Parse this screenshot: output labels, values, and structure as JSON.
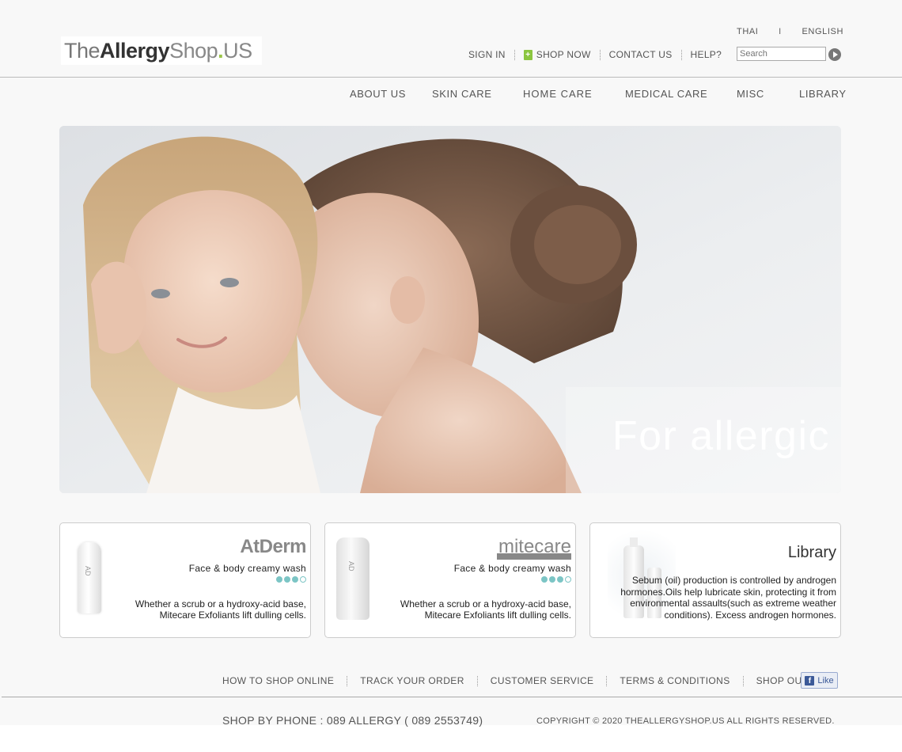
{
  "header": {
    "logo": {
      "part1": "The",
      "part2": "Allergy",
      "part3": "Shop",
      "dot": ".",
      "part4": "US"
    },
    "languages": [
      "THAI",
      "I",
      "ENGLISH"
    ],
    "utility_links": [
      "SIGN IN",
      "SHOP NOW",
      "CONTACT US",
      "HELP?"
    ],
    "search": {
      "placeholder": "Search"
    }
  },
  "nav": [
    "ABOUT US",
    "SKIN CARE",
    "HOME CARE",
    "MEDICAL CARE",
    "MISC",
    "LIBRARY"
  ],
  "hero": {
    "caption": "For allergic"
  },
  "cards": [
    {
      "brand": "AtDerm",
      "tagline": "Face & body creamy wash",
      "rating_filled": 3,
      "rating_total": 4,
      "desc_line1": "Whether a scrub or a hydroxy-acid base,",
      "desc_line2": "Mitecare Exfoliants lift dulling cells."
    },
    {
      "brand": "mitecare",
      "tagline": "Face & body creamy wash",
      "rating_filled": 3,
      "rating_total": 4,
      "desc_line1": "Whether a scrub or a hydroxy-acid base,",
      "desc_line2": "Mitecare Exfoliants lift dulling cells."
    },
    {
      "title": "Library",
      "desc": "Sebum (oil) production is controlled by androgen hormones.Oils help lubricate skin, protecting it from environmental assaults(such as extreme weather conditions). Excess androgen hormones."
    }
  ],
  "footer": {
    "links": [
      "HOW TO SHOP ONLINE",
      "TRACK YOUR ORDER",
      "CUSTOMER SERVICE",
      "TERMS & CONDITIONS",
      "SHOP OUR ADS"
    ],
    "like_label": "Like",
    "phone": "SHOP BY PHONE : 089 ALLERGY ( 089 2553749)",
    "copyright": "COPYRIGHT © 2020 THEALLERGYSHOP.US  ALL RIGHTS RESERVED."
  },
  "colors": {
    "accent_green": "#8bc53f",
    "rating_teal": "#7cc5c5",
    "facebook_blue": "#3b5998"
  }
}
